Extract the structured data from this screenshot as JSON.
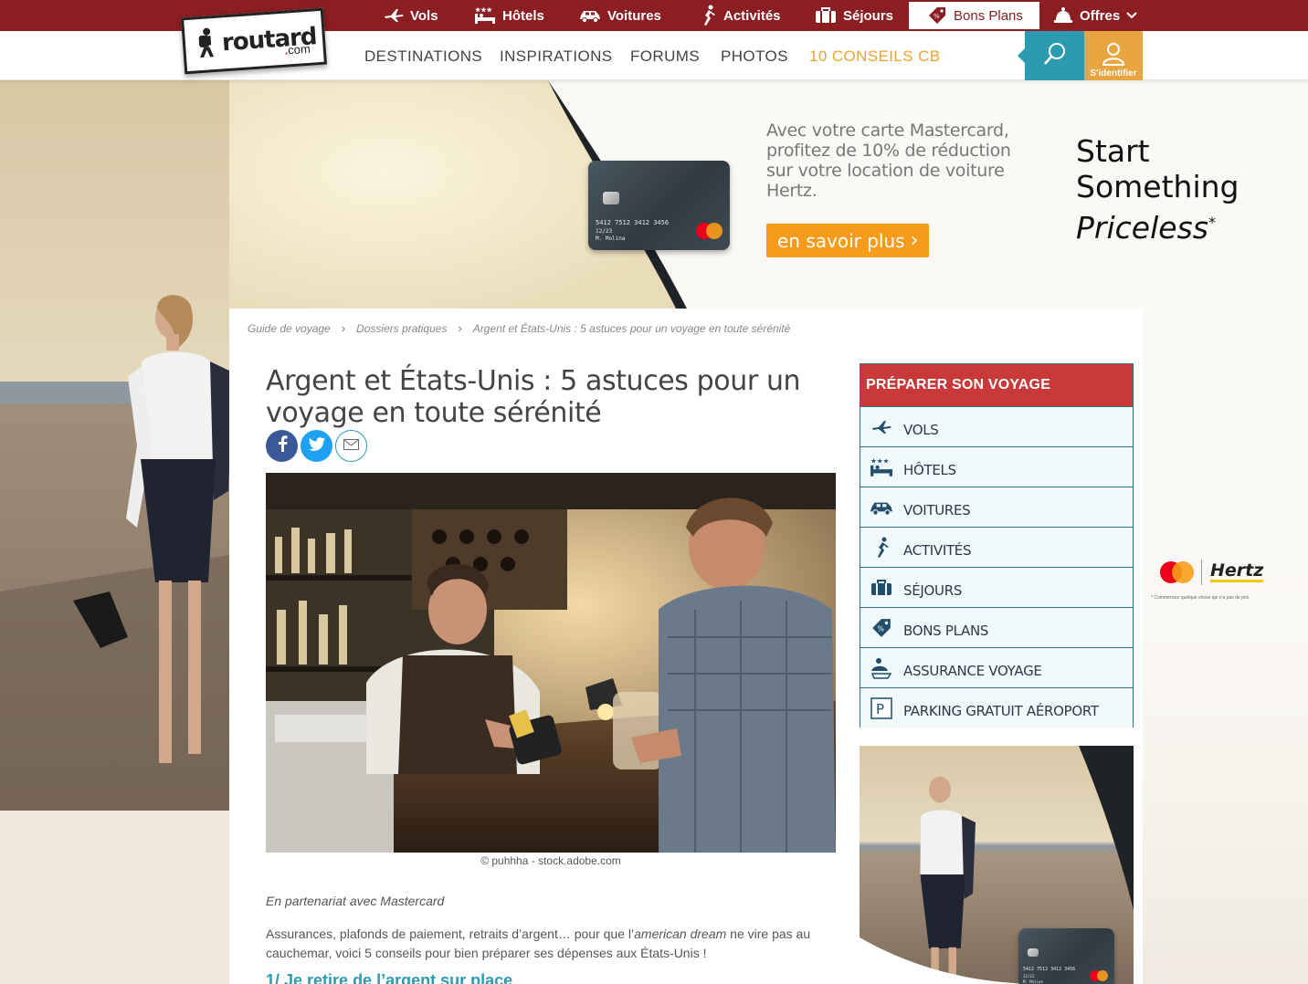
{
  "topbar": {
    "items": [
      {
        "label": "Vols",
        "icon": "plane-icon"
      },
      {
        "label": "Hôtels",
        "icon": "hotel-bed-icon"
      },
      {
        "label": "Voitures",
        "icon": "car-icon"
      },
      {
        "label": "Activités",
        "icon": "running-person-icon"
      },
      {
        "label": "Séjours",
        "icon": "suitcase-icon"
      },
      {
        "label": "Bons Plans",
        "icon": "price-tag-icon"
      },
      {
        "label": "Offres",
        "icon": "bell-icon"
      }
    ]
  },
  "logo": {
    "word": "routard",
    "dot": ".",
    "suffix": "com"
  },
  "nav": {
    "links": [
      "DESTINATIONS",
      "INSPIRATIONS",
      "FORUMS",
      "PHOTOS",
      "10 CONSEILS CB"
    ],
    "login_label": "S'identifier"
  },
  "ad": {
    "text": "Avec votre carte Mastercard, profitez de 10% de réduction sur votre location de voiture Hertz.",
    "cta": "en savoir plus",
    "slogan_line1": "Start",
    "slogan_line2": "Something",
    "slogan_line3": "Priceless",
    "slogan_mark": "*",
    "card_number": "5412 7512 3412 3456",
    "card_expiry": "12/23",
    "card_holder": "M. Molina",
    "right_brand": "Hertz",
    "right_disclaimer": "* Commencez quelque chose qui n'a pas de prix."
  },
  "breadcrumb": [
    "Guide de voyage",
    "Dossiers pratiques",
    "Argent et États-Unis : 5 astuces pour un voyage en toute sérénité"
  ],
  "article": {
    "title": "Argent et États-Unis : 5 astuces pour un voyage en toute sérénité",
    "photo_credit": "© puhhha - stock.adobe.com",
    "partner": "En partenariat avec Mastercard",
    "intro_before": "Assurances, plafonds de paiement, retraits d’argent… pour que l’",
    "intro_em": "american dream",
    "intro_after": " ne vire pas au cauchemar, voici 5 conseils pour bien préparer ses dépenses aux États-Unis !",
    "h2": "1/ Je retire de l’argent sur place"
  },
  "sidebar": {
    "title": "PRÉPARER SON VOYAGE",
    "items": [
      {
        "label": "VOLS",
        "icon": "plane-icon"
      },
      {
        "label": "HÔTELS",
        "icon": "hotel-bed-icon"
      },
      {
        "label": "VOITURES",
        "icon": "car-icon"
      },
      {
        "label": "ACTIVITÉS",
        "icon": "running-person-icon"
      },
      {
        "label": "SÉJOURS",
        "icon": "suitcase-icon"
      },
      {
        "label": "BONS PLANS",
        "icon": "price-tag-icon"
      },
      {
        "label": "ASSURANCE VOYAGE",
        "icon": "insurance-umbrella-icon"
      },
      {
        "label": "PARKING GRATUIT AÉROPORT",
        "icon": "parking-icon"
      }
    ]
  },
  "colors": {
    "topbar": "#8a1e22",
    "accent_teal": "#2a9bb1",
    "accent_orange": "#f0a12d",
    "sidebar_head": "#c9393a",
    "cta_orange": "#f79b1b"
  }
}
